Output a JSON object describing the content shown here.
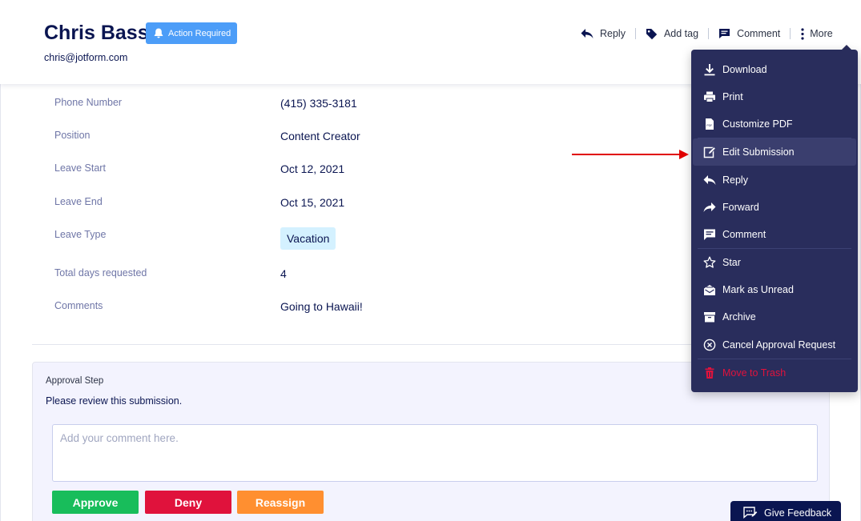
{
  "header": {
    "name": "Chris Bass",
    "badge": "Action Required",
    "email": "chris@jotform.com",
    "actions": {
      "reply": "Reply",
      "add_tag": "Add tag",
      "comment": "Comment",
      "more": "More"
    }
  },
  "fields": [
    {
      "label": "Phone Number",
      "value": "(415) 335-3181"
    },
    {
      "label": "Position",
      "value": "Content Creator"
    },
    {
      "label": "Leave Start",
      "value": "Oct 12, 2021"
    },
    {
      "label": "Leave End",
      "value": "Oct 15, 2021"
    },
    {
      "label": "Leave Type",
      "value": "Vacation"
    },
    {
      "label": "Total days requested",
      "value": "4"
    },
    {
      "label": "Comments",
      "value": "Going to Hawaii!"
    }
  ],
  "approval": {
    "title": "Approval Step",
    "description": "Please review this submission.",
    "comment_placeholder": "Add your comment here.",
    "approve": "Approve",
    "deny": "Deny",
    "reassign": "Reassign"
  },
  "menu": {
    "items": [
      {
        "label": "Download",
        "icon": "download-icon"
      },
      {
        "label": "Print",
        "icon": "print-icon"
      },
      {
        "label": "Customize PDF",
        "icon": "pdf-icon"
      },
      {
        "label": "Edit Submission",
        "icon": "edit-icon"
      },
      {
        "label": "Reply",
        "icon": "reply-icon"
      },
      {
        "label": "Forward",
        "icon": "forward-icon"
      },
      {
        "label": "Comment",
        "icon": "comment-icon"
      },
      {
        "label": "Star",
        "icon": "star-icon"
      },
      {
        "label": "Mark as Unread",
        "icon": "mark-unread-icon"
      },
      {
        "label": "Archive",
        "icon": "archive-icon"
      },
      {
        "label": "Cancel Approval Request",
        "icon": "cancel-circle-icon"
      },
      {
        "label": "Move to Trash",
        "icon": "trash-icon"
      }
    ]
  },
  "feedback": {
    "label": "Give Feedback"
  },
  "colors": {
    "primary_text": "#0a1551",
    "badge": "#4c9df8",
    "menu_bg": "#292d5c",
    "approve": "#18bd5b",
    "deny": "#e0123c",
    "reassign": "#ff8f30",
    "tag_bg": "#d4f1ff",
    "annotation_arrow": "#e00000"
  }
}
